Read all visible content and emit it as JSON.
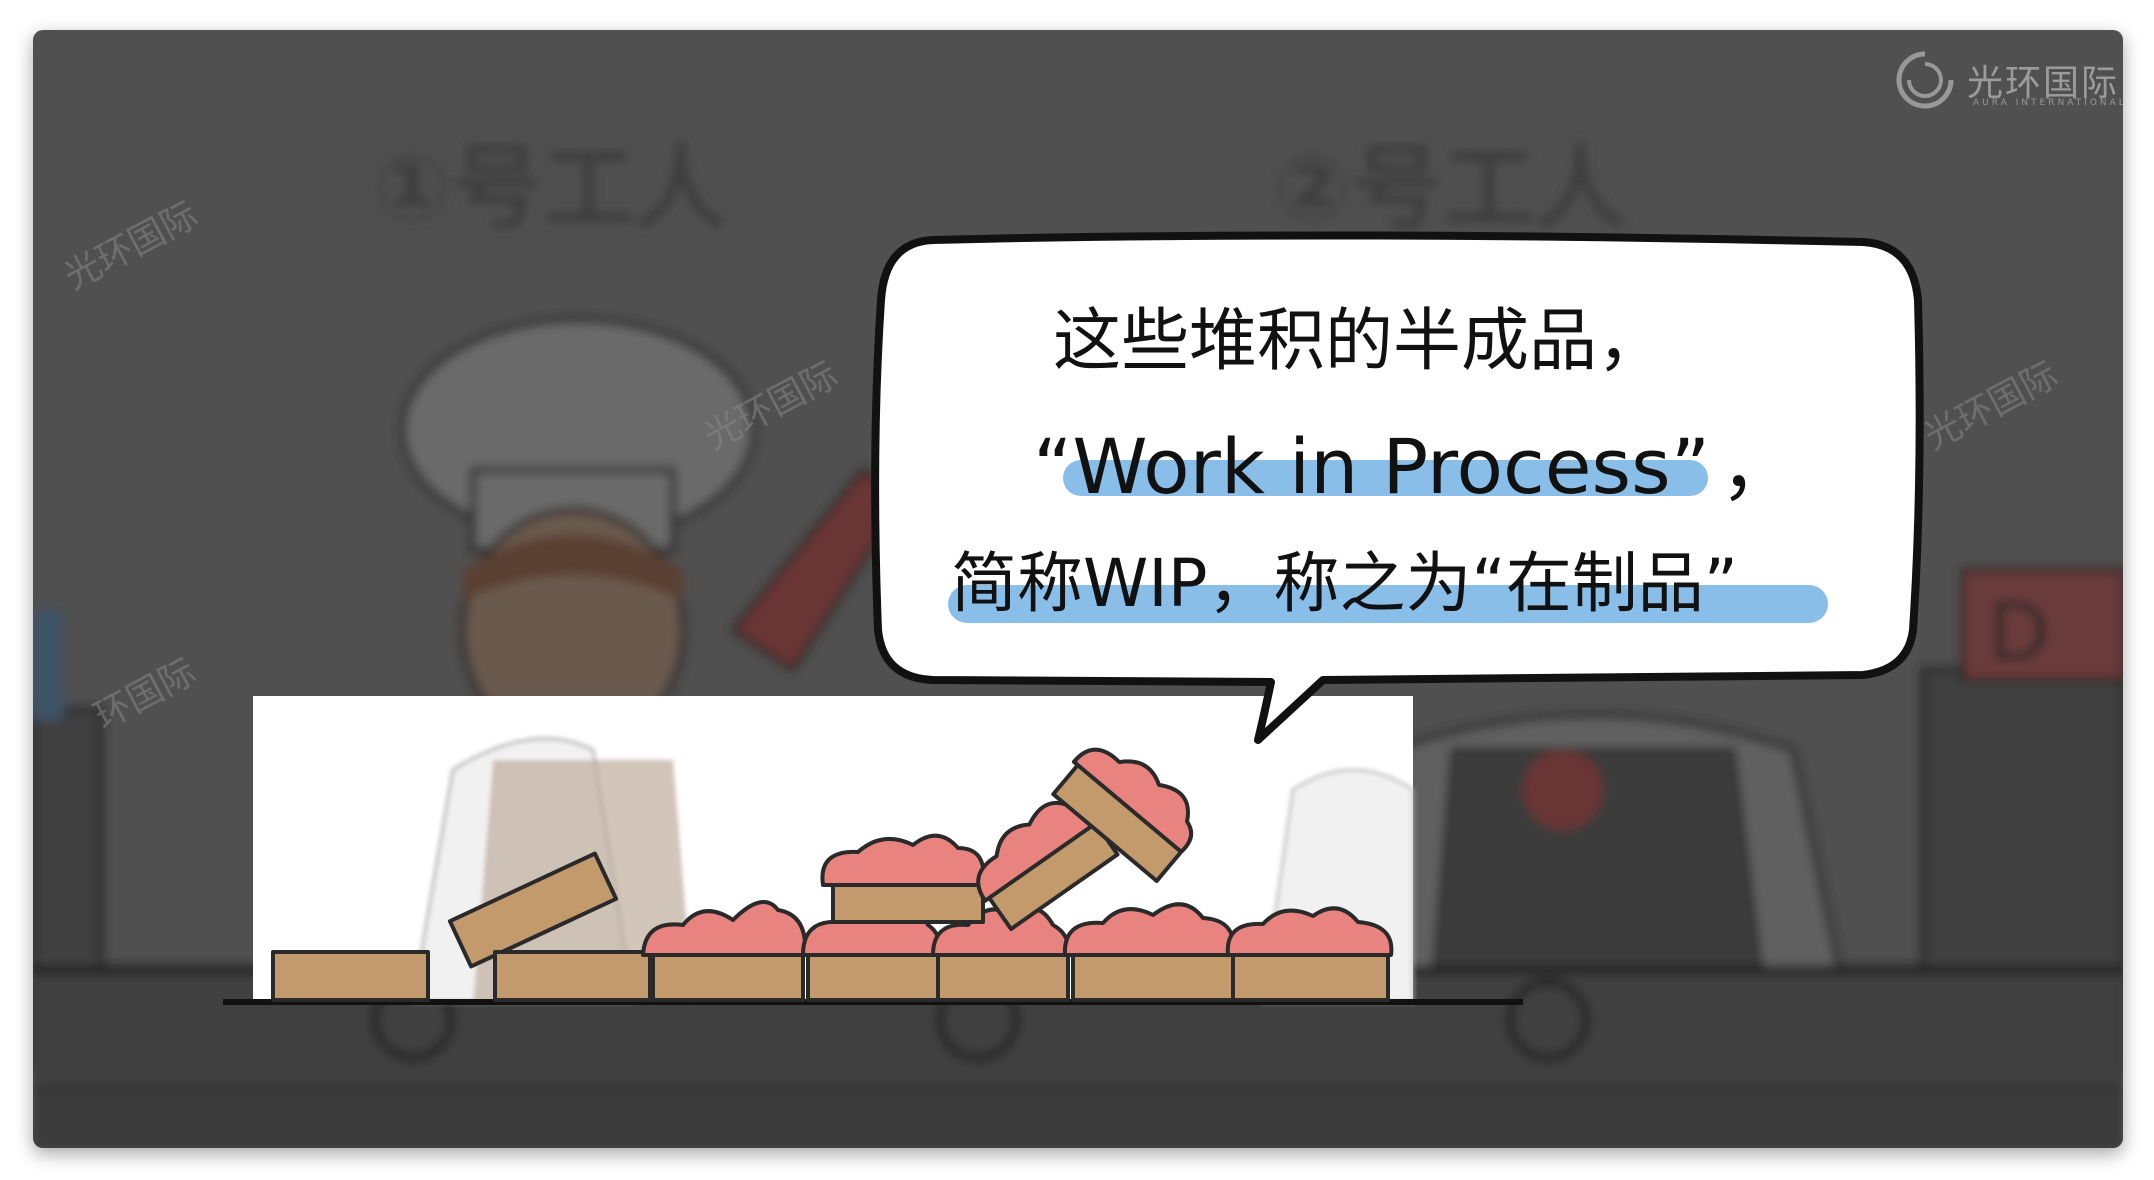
{
  "logo": {
    "text": "光环国际",
    "subtext": "AURA INTERNATIONAL",
    "icon": "aura-swirl-icon"
  },
  "background_labels": {
    "worker1": "①号工人",
    "worker2": "②号工人",
    "sign": "D"
  },
  "watermarks": [
    "光环国际",
    "光环国际",
    "环国际",
    "光环国际"
  ],
  "bubble": {
    "line1": "这些堆积的半成品，",
    "line2_quote_open": "“",
    "line2_main": "Work in Process",
    "line2_quote_close": "”",
    "line2_comma": "，",
    "line3": "简称WIP，称之为“在制品”"
  },
  "colors": {
    "background": "#505050",
    "highlight": "#7cb7e6",
    "cake": "#c29a6b",
    "frosting": "#e8837f",
    "bubble_fill": "#ffffff"
  }
}
